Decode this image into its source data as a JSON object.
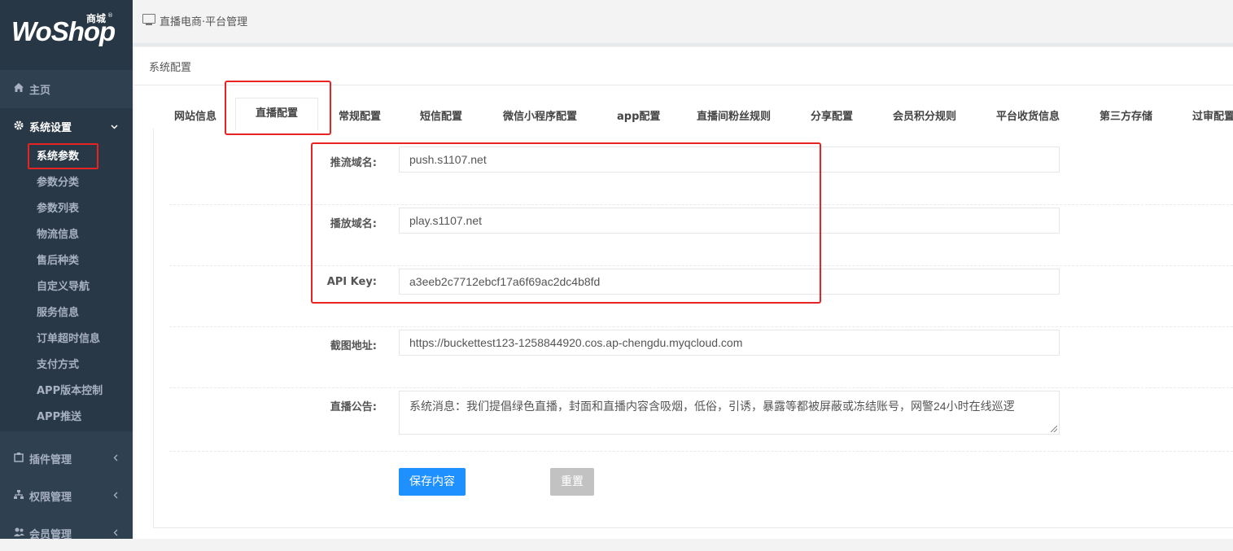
{
  "app": {
    "logo_text": "WoShop",
    "logo_badge": "商城",
    "logo_reg": "®"
  },
  "sidebar": {
    "home": {
      "label": "主页",
      "icon": "home-icon"
    },
    "system": {
      "label": "系统设置",
      "icon": "gear-icon"
    },
    "sub_items": [
      {
        "label": "系统参数"
      },
      {
        "label": "参数分类"
      },
      {
        "label": "参数列表"
      },
      {
        "label": "物流信息"
      },
      {
        "label": "售后种类"
      },
      {
        "label": "自定义导航"
      },
      {
        "label": "服务信息"
      },
      {
        "label": "订单超时信息"
      },
      {
        "label": "支付方式"
      },
      {
        "label": "APP版本控制"
      },
      {
        "label": "APP推送"
      }
    ],
    "plugins": {
      "label": "插件管理",
      "icon": "plugin-icon"
    },
    "permissions": {
      "label": "权限管理",
      "icon": "sitemap-icon"
    },
    "members": {
      "label": "会员管理",
      "icon": "users-icon"
    }
  },
  "topbar": {
    "breadcrumb": "直播电商·平台管理",
    "icon": "monitor-icon"
  },
  "panel": {
    "title": "系统配置",
    "tabs": [
      "网站信息",
      "直播配置",
      "常规配置",
      "短信配置",
      "微信小程序配置",
      "app配置",
      "直播间粉丝规则",
      "分享配置",
      "会员积分规则",
      "平台收货信息",
      "第三方存储",
      "过审配置"
    ],
    "active_tab": "直播配置"
  },
  "form": {
    "push_domain": {
      "label": "推流域名:",
      "value": "push.s1107.net"
    },
    "play_domain": {
      "label": "播放域名:",
      "value": "play.s1107.net"
    },
    "api_key": {
      "label": "API Key:",
      "value": "a3eeb2c7712ebcf17a6f69ac2dc4b8fd"
    },
    "screenshot_url": {
      "label": "截图地址:",
      "value": "https://buckettest123-1258844920.cos.ap-chengdu.myqcloud.com"
    },
    "notice": {
      "label": "直播公告:",
      "value": "系统消息：我们提倡绿色直播，封面和直播内容含吸烟，低俗，引诱，暴露等都被屏蔽或冻结账号，网警24小时在线巡逻"
    }
  },
  "buttons": {
    "save": "保存内容",
    "reset": "重置"
  },
  "colors": {
    "sidebar_bg": "#2f4050",
    "primary_button": "#1e90ff",
    "highlight_box": "#e82323"
  }
}
